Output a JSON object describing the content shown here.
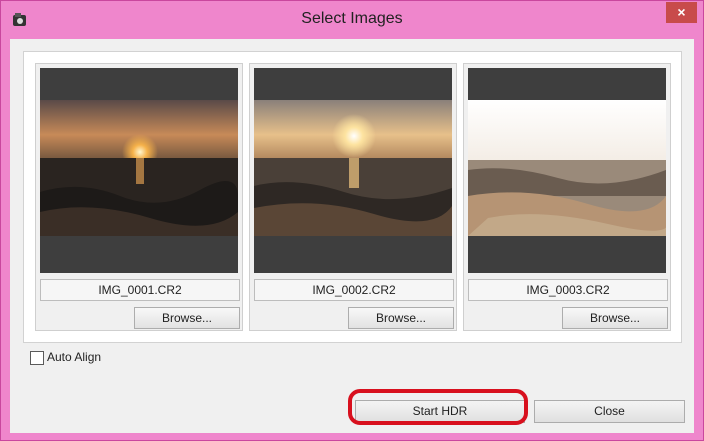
{
  "window": {
    "title": "Select Images",
    "close_label": "×"
  },
  "images": [
    {
      "filename": "IMG_0001.CR2",
      "browse_label": "Browse..."
    },
    {
      "filename": "IMG_0002.CR2",
      "browse_label": "Browse..."
    },
    {
      "filename": "IMG_0003.CR2",
      "browse_label": "Browse..."
    }
  ],
  "options": {
    "auto_align_label": "Auto Align",
    "auto_align_checked": false
  },
  "buttons": {
    "start_hdr": "Start HDR",
    "close": "Close"
  },
  "colors": {
    "title_bar": "#ef86cc",
    "highlight": "#d8101e"
  }
}
